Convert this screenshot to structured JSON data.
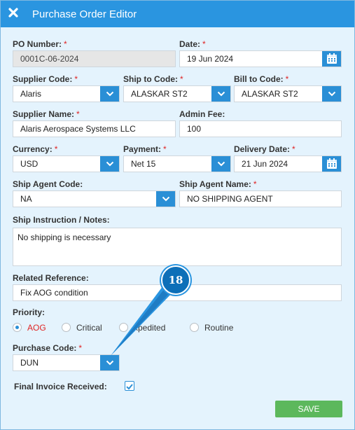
{
  "window": {
    "title": "Purchase Order Editor",
    "close_icon": "close-icon"
  },
  "po_number": {
    "label": "PO Number:",
    "value": "0001C-06-2024"
  },
  "date": {
    "label": "Date:",
    "value": "19 Jun 2024"
  },
  "supplier_code": {
    "label": "Supplier Code:",
    "value": "Alaris"
  },
  "ship_to_code": {
    "label": "Ship to Code:",
    "value": "ALASKAR ST2"
  },
  "bill_to_code": {
    "label": "Bill to Code:",
    "value": "ALASKAR ST2"
  },
  "supplier_name": {
    "label": "Supplier Name:",
    "value": "Alaris Aerospace Systems LLC"
  },
  "admin_fee": {
    "label": "Admin Fee:",
    "value": "100"
  },
  "currency": {
    "label": "Currency:",
    "value": "USD"
  },
  "payment": {
    "label": "Payment:",
    "value": "Net 15"
  },
  "delivery_date": {
    "label": "Delivery Date:",
    "value": "21 Jun 2024"
  },
  "ship_agent_code": {
    "label": "Ship Agent Code:",
    "value": "NA"
  },
  "ship_agent_name": {
    "label": "Ship Agent Name:",
    "value": "NO SHIPPING AGENT"
  },
  "ship_instruction": {
    "label": "Ship Instruction / Notes:",
    "value": "No shipping is necessary"
  },
  "related_reference": {
    "label": "Related Reference:",
    "value": "Fix AOG condition"
  },
  "priority": {
    "label": "Priority:",
    "options": [
      "AOG",
      "Critical",
      "Expedited",
      "Routine"
    ],
    "visible_options": [
      "AOG",
      "Critical",
      "xpedited",
      "Routine"
    ],
    "selected": "AOG"
  },
  "purchase_code": {
    "label": "Purchase Code:",
    "value": "DUN"
  },
  "final_invoice": {
    "label": "Final Invoice Received:",
    "checked": true
  },
  "save_label": "SAVE",
  "required_mark": "*",
  "callout": {
    "number": "18"
  },
  "colors": {
    "header": "#2a95e0",
    "button": "#2a8fd6",
    "save": "#5cb85c",
    "required": "#e02424",
    "callout": "#0d6fb8"
  }
}
